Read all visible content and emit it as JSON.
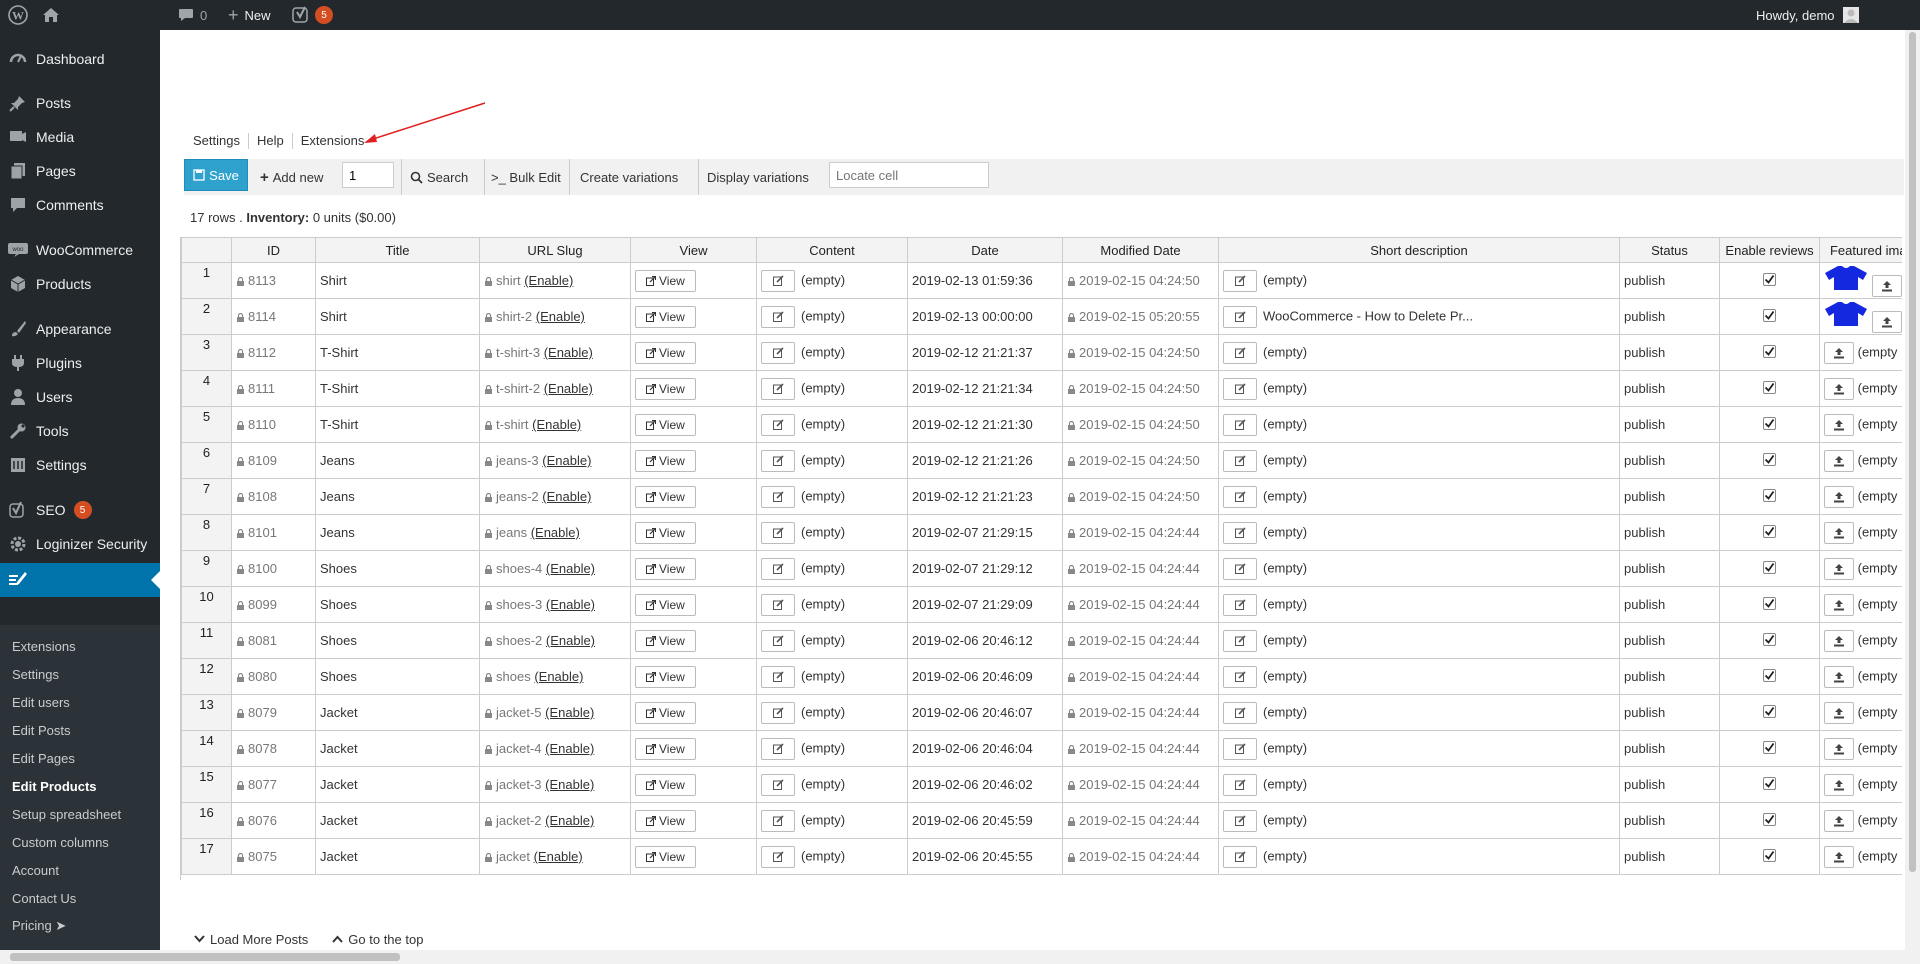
{
  "adminbar": {
    "comments_count": "0",
    "new_label": "New",
    "yoast_count": "5",
    "greeting": "Howdy, demo"
  },
  "sidebar": {
    "items": [
      {
        "label": "Dashboard",
        "icon": "dashboard-icon"
      },
      {
        "label": "Posts",
        "icon": "pin-icon"
      },
      {
        "label": "Media",
        "icon": "media-icon"
      },
      {
        "label": "Pages",
        "icon": "pages-icon"
      },
      {
        "label": "Comments",
        "icon": "comments-icon"
      },
      {
        "label": "WooCommerce",
        "icon": "woocommerce-icon"
      },
      {
        "label": "Products",
        "icon": "products-icon"
      },
      {
        "label": "Appearance",
        "icon": "brush-icon"
      },
      {
        "label": "Plugins",
        "icon": "plugin-icon"
      },
      {
        "label": "Users",
        "icon": "users-icon"
      },
      {
        "label": "Tools",
        "icon": "wrench-icon"
      },
      {
        "label": "Settings",
        "icon": "settings-icon"
      },
      {
        "label": "SEO",
        "icon": "yoast-icon",
        "badge": "5"
      },
      {
        "label": "Loginizer Security",
        "icon": "gear-icon"
      }
    ],
    "submenu": [
      "Extensions",
      "Settings",
      "Edit users",
      "Edit Posts",
      "Edit Pages",
      "Edit Products",
      "Setup spreadsheet",
      "Custom columns",
      "Account",
      "Contact Us",
      "Pricing ➤"
    ],
    "active_submenu": "Edit Products"
  },
  "tabs": [
    "Settings",
    "Help",
    "Extensions"
  ],
  "toolbar": {
    "save_label": "Save",
    "add_new_label": "Add new",
    "add_new_value": "1",
    "search_label": "Search",
    "bulk_edit_label": ">_ Bulk Edit",
    "create_variations_label": "Create variations",
    "display_variations_label": "Display variations",
    "locate_placeholder": "Locate cell"
  },
  "summary": {
    "rows": "17 rows .",
    "inventory_label": "Inventory:",
    "inventory_value": "0 units ($0.00)"
  },
  "columns": [
    "ID",
    "Title",
    "URL Slug",
    "View",
    "Content",
    "Date",
    "Modified Date",
    "Short description",
    "Status",
    "Enable reviews",
    "Featured image"
  ],
  "rows": [
    {
      "n": "1",
      "id": "8113",
      "title": "Shirt",
      "slug": "shirt",
      "content": "(empty)",
      "date": "2019-02-13 01:59:36",
      "modified": "2019-02-15 04:24:50",
      "short": "(empty)",
      "status": "publish",
      "reviews": true,
      "image": "shirt"
    },
    {
      "n": "2",
      "id": "8114",
      "title": "Shirt",
      "slug": "shirt-2",
      "content": "(empty)",
      "date": "2019-02-13 00:00:00",
      "modified": "2019-02-15 05:20:55",
      "short": "WooCommerce - How to Delete Pr...",
      "status": "publish",
      "reviews": true,
      "image": "shirt"
    },
    {
      "n": "3",
      "id": "8112",
      "title": "T-Shirt",
      "slug": "t-shirt-3",
      "content": "(empty)",
      "date": "2019-02-12 21:21:37",
      "modified": "2019-02-15 04:24:50",
      "short": "(empty)",
      "status": "publish",
      "reviews": true,
      "image": "(empty"
    },
    {
      "n": "4",
      "id": "8111",
      "title": "T-Shirt",
      "slug": "t-shirt-2",
      "content": "(empty)",
      "date": "2019-02-12 21:21:34",
      "modified": "2019-02-15 04:24:50",
      "short": "(empty)",
      "status": "publish",
      "reviews": true,
      "image": "(empty"
    },
    {
      "n": "5",
      "id": "8110",
      "title": "T-Shirt",
      "slug": "t-shirt",
      "content": "(empty)",
      "date": "2019-02-12 21:21:30",
      "modified": "2019-02-15 04:24:50",
      "short": "(empty)",
      "status": "publish",
      "reviews": true,
      "image": "(empty"
    },
    {
      "n": "6",
      "id": "8109",
      "title": "Jeans",
      "slug": "jeans-3",
      "content": "(empty)",
      "date": "2019-02-12 21:21:26",
      "modified": "2019-02-15 04:24:50",
      "short": "(empty)",
      "status": "publish",
      "reviews": true,
      "image": "(empty"
    },
    {
      "n": "7",
      "id": "8108",
      "title": "Jeans",
      "slug": "jeans-2",
      "content": "(empty)",
      "date": "2019-02-12 21:21:23",
      "modified": "2019-02-15 04:24:50",
      "short": "(empty)",
      "status": "publish",
      "reviews": true,
      "image": "(empty"
    },
    {
      "n": "8",
      "id": "8101",
      "title": "Jeans",
      "slug": "jeans",
      "content": "(empty)",
      "date": "2019-02-07 21:29:15",
      "modified": "2019-02-15 04:24:44",
      "short": "(empty)",
      "status": "publish",
      "reviews": true,
      "image": "(empty"
    },
    {
      "n": "9",
      "id": "8100",
      "title": "Shoes",
      "slug": "shoes-4",
      "content": "(empty)",
      "date": "2019-02-07 21:29:12",
      "modified": "2019-02-15 04:24:44",
      "short": "(empty)",
      "status": "publish",
      "reviews": true,
      "image": "(empty"
    },
    {
      "n": "10",
      "id": "8099",
      "title": "Shoes",
      "slug": "shoes-3",
      "content": "(empty)",
      "date": "2019-02-07 21:29:09",
      "modified": "2019-02-15 04:24:44",
      "short": "(empty)",
      "status": "publish",
      "reviews": true,
      "image": "(empty"
    },
    {
      "n": "11",
      "id": "8081",
      "title": "Shoes",
      "slug": "shoes-2",
      "content": "(empty)",
      "date": "2019-02-06 20:46:12",
      "modified": "2019-02-15 04:24:44",
      "short": "(empty)",
      "status": "publish",
      "reviews": true,
      "image": "(empty"
    },
    {
      "n": "12",
      "id": "8080",
      "title": "Shoes",
      "slug": "shoes",
      "content": "(empty)",
      "date": "2019-02-06 20:46:09",
      "modified": "2019-02-15 04:24:44",
      "short": "(empty)",
      "status": "publish",
      "reviews": true,
      "image": "(empty"
    },
    {
      "n": "13",
      "id": "8079",
      "title": "Jacket",
      "slug": "jacket-5",
      "content": "(empty)",
      "date": "2019-02-06 20:46:07",
      "modified": "2019-02-15 04:24:44",
      "short": "(empty)",
      "status": "publish",
      "reviews": true,
      "image": "(empty"
    },
    {
      "n": "14",
      "id": "8078",
      "title": "Jacket",
      "slug": "jacket-4",
      "content": "(empty)",
      "date": "2019-02-06 20:46:04",
      "modified": "2019-02-15 04:24:44",
      "short": "(empty)",
      "status": "publish",
      "reviews": true,
      "image": "(empty"
    },
    {
      "n": "15",
      "id": "8077",
      "title": "Jacket",
      "slug": "jacket-3",
      "content": "(empty)",
      "date": "2019-02-06 20:46:02",
      "modified": "2019-02-15 04:24:44",
      "short": "(empty)",
      "status": "publish",
      "reviews": true,
      "image": "(empty"
    },
    {
      "n": "16",
      "id": "8076",
      "title": "Jacket",
      "slug": "jacket-2",
      "content": "(empty)",
      "date": "2019-02-06 20:45:59",
      "modified": "2019-02-15 04:24:44",
      "short": "(empty)",
      "status": "publish",
      "reviews": true,
      "image": "(empty"
    },
    {
      "n": "17",
      "id": "8075",
      "title": "Jacket",
      "slug": "jacket",
      "content": "(empty)",
      "date": "2019-02-06 20:45:55",
      "modified": "2019-02-15 04:24:44",
      "short": "(empty)",
      "status": "publish",
      "reviews": true,
      "image": "(empty"
    }
  ],
  "labels": {
    "enable": "(Enable)",
    "view": "View"
  },
  "footer": {
    "load_more": "Load More Posts",
    "go_top": "Go to the top"
  },
  "colors": {
    "accent": "#0073aa",
    "save": "#2ea2cc",
    "annotation_arrow": "#e02020",
    "shirt": "#1428e0"
  }
}
